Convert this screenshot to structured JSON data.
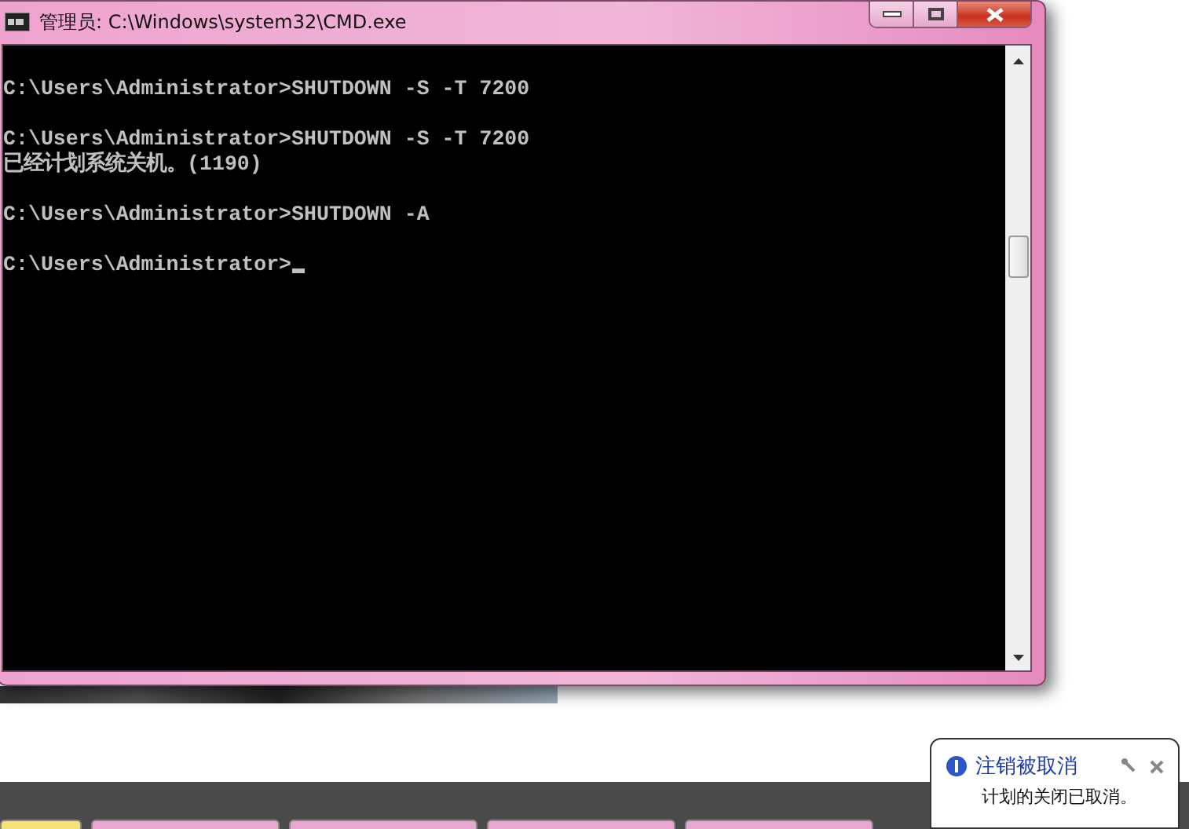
{
  "window": {
    "title": "管理员: C:\\Windows\\system32\\CMD.exe"
  },
  "console": {
    "blocks": [
      [
        "C:\\Users\\Administrator>SHUTDOWN -S -T 7200"
      ],
      [
        "C:\\Users\\Administrator>SHUTDOWN -S -T 7200",
        "已经计划系统关机。(1190)"
      ],
      [
        "C:\\Users\\Administrator>SHUTDOWN -A"
      ],
      [
        "C:\\Users\\Administrator>"
      ]
    ],
    "cursor": true
  },
  "notification": {
    "title": "注销被取消",
    "message": "计划的关闭已取消。"
  }
}
